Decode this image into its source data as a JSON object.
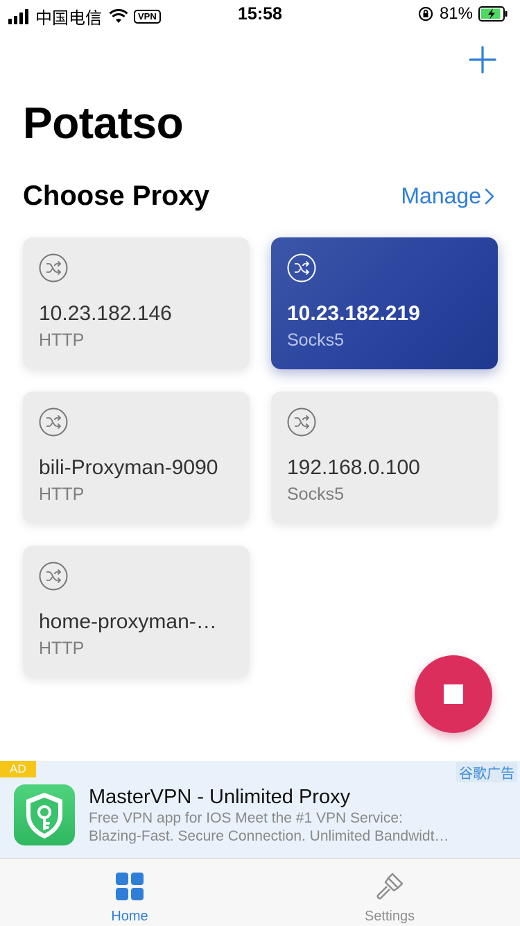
{
  "status_bar": {
    "carrier": "中国电信",
    "vpn": "VPN",
    "time": "15:58",
    "battery": "81%"
  },
  "header": {
    "add_icon": "plus-icon",
    "title": "Potatso"
  },
  "section": {
    "title": "Choose Proxy",
    "manage_label": "Manage"
  },
  "proxies": [
    {
      "name": "10.23.182.146",
      "protocol": "HTTP",
      "selected": false
    },
    {
      "name": "10.23.182.219",
      "protocol": "Socks5",
      "selected": true
    },
    {
      "name": "bili-Proxyman-9090",
      "protocol": "HTTP",
      "selected": false
    },
    {
      "name": "192.168.0.100",
      "protocol": "Socks5",
      "selected": false
    },
    {
      "name": "home-proxyman-…",
      "protocol": "HTTP",
      "selected": false
    }
  ],
  "fab": {
    "icon": "stop-icon"
  },
  "ad": {
    "badge": "AD",
    "network": "谷歌广告",
    "title": "MasterVPN - Unlimited Proxy",
    "desc_line1": "Free VPN app for IOS Meet the #1 VPN Service:",
    "desc_line2": "Blazing-Fast. Secure Connection. Unlimited Bandwidt…"
  },
  "tabs": [
    {
      "label": "Home",
      "icon": "grid-icon",
      "active": true
    },
    {
      "label": "Settings",
      "icon": "brush-icon",
      "active": false
    }
  ],
  "colors": {
    "accent": "#2f7fd9",
    "selected_card": "#2a44a0",
    "stop_button": "#dc2e5d",
    "card_bg": "#ececec"
  }
}
